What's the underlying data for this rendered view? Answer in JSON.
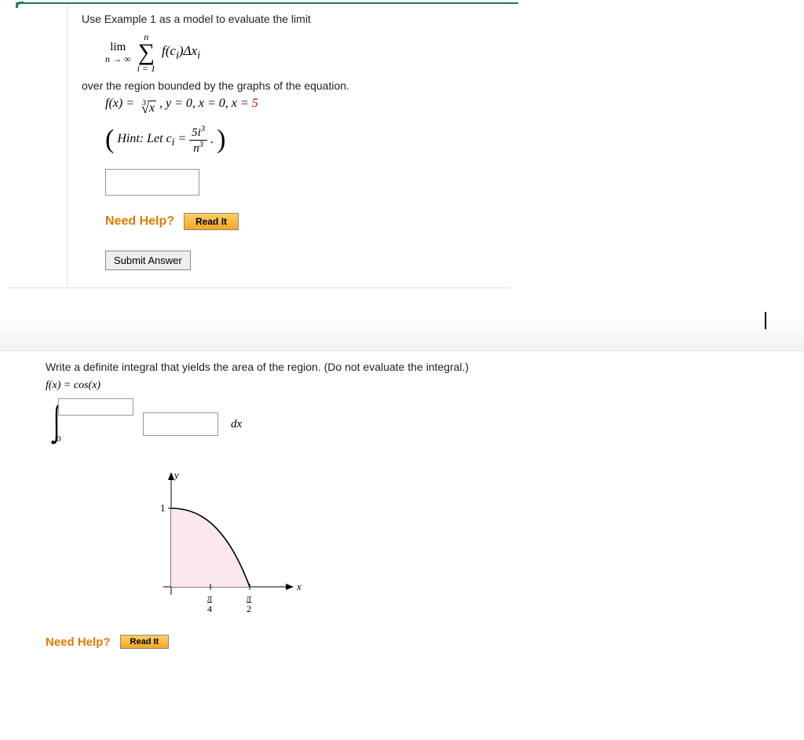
{
  "q1": {
    "instruction": "Use Example 1 as a model to evaluate the limit",
    "lim_label": "lim",
    "lim_sub": "n → ∞",
    "sigma_top": "n",
    "sigma_bottom": "i = 1",
    "summand_fc": "f(c",
    "summand_i1": "i",
    "summand_mid": ")Δx",
    "summand_i2": "i",
    "over_text": "over the region bounded by the graphs of the equation.",
    "fx_lhs": "f(x) = ",
    "cuberoot_index": "3",
    "cuberoot_arg": "x",
    "fx_rhs": ", y = 0, x = 0, x = ",
    "fx_red": "5",
    "hint_label": "Hint:",
    "hint_text_a": " Let c",
    "hint_sub_i": "i",
    "hint_text_b": " = ",
    "hint_frac_num_a": "5i",
    "hint_frac_num_sup": "3",
    "hint_frac_den_a": "n",
    "hint_frac_den_sup": "3",
    "hint_tail": "."
  },
  "need_help_label": "Need Help?",
  "read_it_label": "Read It",
  "submit_label": "Submit Answer",
  "q2": {
    "instruction": "Write a definite integral that yields the area of the region. (Do not evaluate the integral.)",
    "fx": "f(x) = cos(x)",
    "lower_limit": "0",
    "dx": "dx",
    "graph": {
      "y_label": "y",
      "x_label": "x",
      "y_tick": "1",
      "x_tick1_num": "π",
      "x_tick1_den": "4",
      "x_tick2_num": "π",
      "x_tick2_den": "2"
    }
  },
  "chart_data": {
    "type": "area",
    "title": "",
    "xlabel": "x",
    "ylabel": "y",
    "xlim": [
      0,
      1.7
    ],
    "ylim": [
      0,
      1.1
    ],
    "x_ticks": [
      "π/4",
      "π/2"
    ],
    "y_ticks": [
      1
    ],
    "series": [
      {
        "name": "cos(x)",
        "x": [
          0,
          0.3927,
          0.7854,
          1.1781,
          1.5708
        ],
        "y": [
          1,
          0.9239,
          0.7071,
          0.3827,
          0
        ]
      }
    ],
    "shaded_region": {
      "from_x": 0,
      "to_x": 1.5708,
      "color": "#fbe7ee"
    }
  }
}
